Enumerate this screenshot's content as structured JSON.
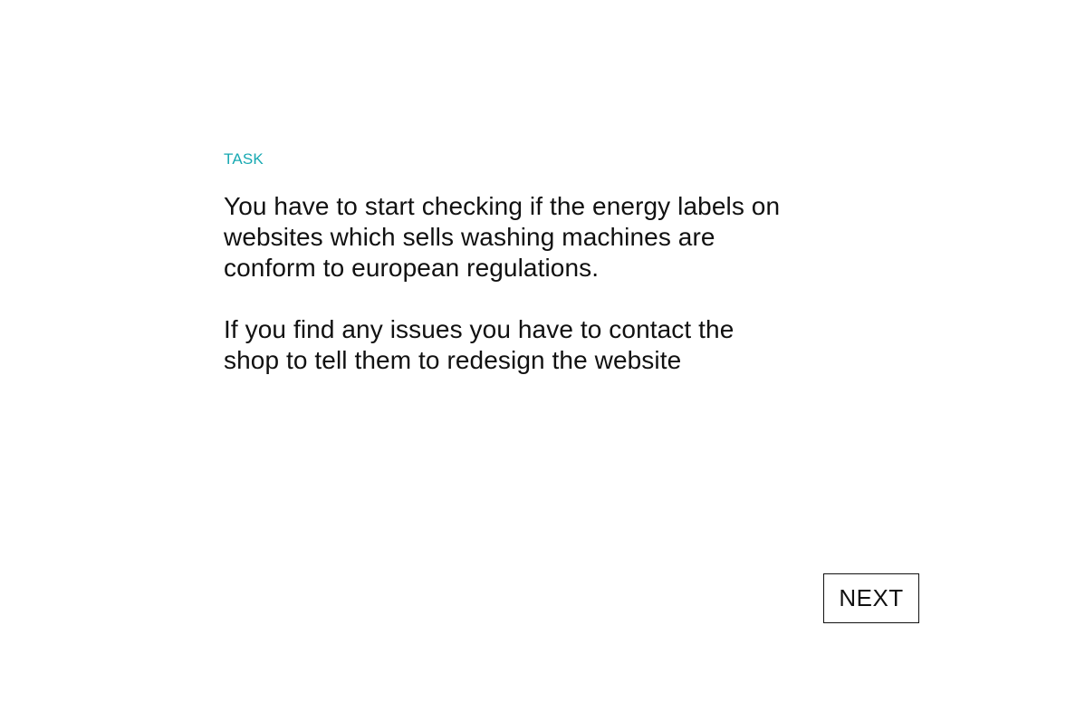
{
  "colors": {
    "accent": "#17a9b2",
    "text": "#111111",
    "background": "#ffffff"
  },
  "task": {
    "label": "TASK",
    "paragraphs": [
      {
        "lines": [
          "You have to start checking if the energy labels on",
          "websites which sells washing machines are",
          "conform to european regulations."
        ]
      },
      {
        "lines": [
          "If you find any issues you have to contact the",
          "shop to tell them to redesign the website"
        ]
      }
    ]
  },
  "footer": {
    "next_label": "NEXT"
  }
}
